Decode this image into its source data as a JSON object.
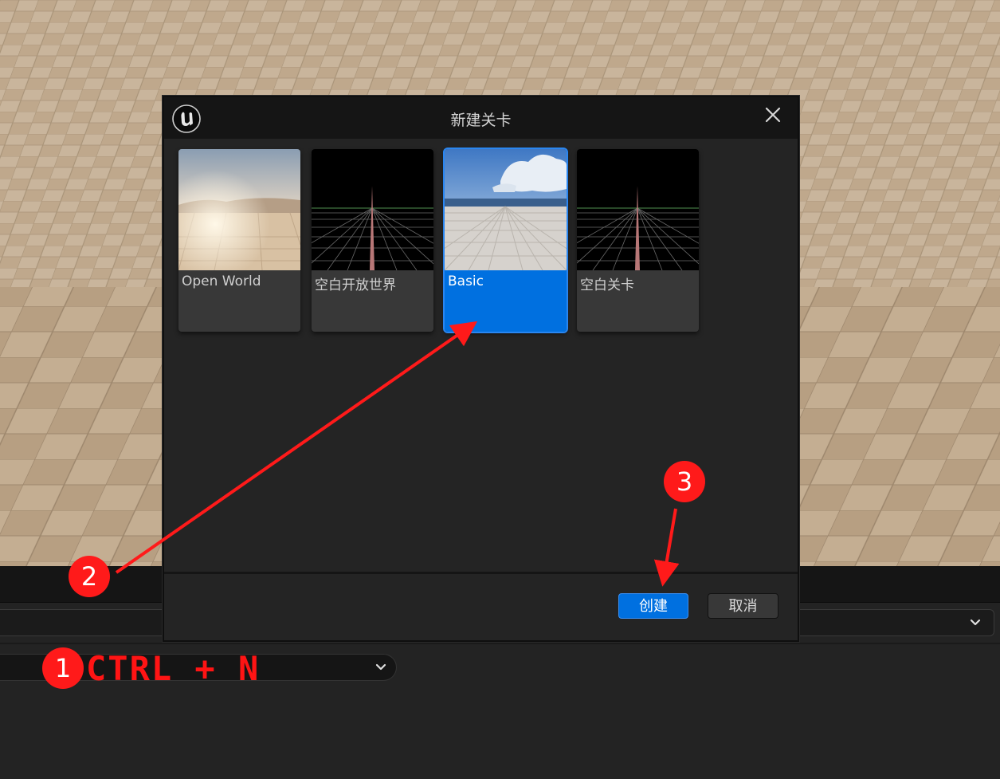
{
  "dialog": {
    "title": "新建关卡",
    "templates": [
      {
        "label": "Open World",
        "thumbnail": "sunset-desert-floor",
        "selected": false
      },
      {
        "label": "空白开放世界",
        "thumbnail": "black-grid",
        "selected": false
      },
      {
        "label": "Basic",
        "thumbnail": "sky-tiled-floor",
        "selected": true
      },
      {
        "label": "空白关卡",
        "thumbnail": "black-grid",
        "selected": false
      }
    ],
    "create_label": "创建",
    "cancel_label": "取消"
  },
  "annotations": {
    "step1": "1",
    "step2": "2",
    "step3": "3",
    "shortcut": "CTRL + N",
    "color": "#ff1a1a"
  },
  "colors": {
    "accent": "#0070e0",
    "dialog_bg": "#242424",
    "titlebar_bg": "#151515"
  }
}
